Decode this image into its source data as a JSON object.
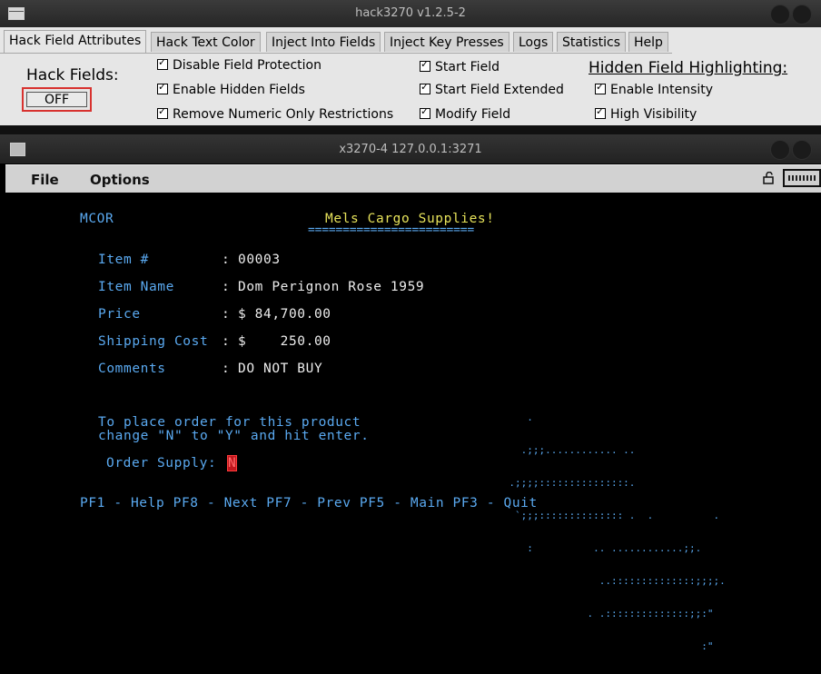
{
  "window": {
    "title": "hack3270 v1.2.5-2"
  },
  "tabs": [
    "Hack Field Attributes",
    "Hack Text Color",
    "Inject Into Fields",
    "Inject Key Presses",
    "Logs",
    "Statistics",
    "Help"
  ],
  "hack_fields": {
    "label": "Hack Fields:",
    "toggle": "OFF"
  },
  "options_left": [
    "Disable Field Protection",
    "Enable Hidden Fields",
    "Remove Numeric Only Restrictions"
  ],
  "options_mid": [
    "Start Field",
    "Start Field Extended",
    "Modify Field"
  ],
  "hidden_highlight": {
    "label": "Hidden Field Highlighting:",
    "options": [
      "Enable Intensity",
      "High Visibility"
    ]
  },
  "terminal_window": {
    "title": "x3270-4 127.0.0.1:3271"
  },
  "terminal_menu": [
    "File",
    "Options"
  ],
  "screen": {
    "code": "MCOR",
    "title": "Mels Cargo Supplies!",
    "underline": "========================",
    "fields": [
      {
        "label": "Item #",
        "value": "00003"
      },
      {
        "label": "Item Name",
        "value": "Dom Perignon Rose 1959"
      },
      {
        "label": "Price",
        "value": "$ 84,700.00"
      },
      {
        "label": "Shipping Cost",
        "value": "$    250.00"
      },
      {
        "label": "Comments",
        "value": "DO NOT BUY"
      }
    ],
    "instruction_1": "To place order for this product",
    "instruction_2": "change \"N\" to \"Y\" and hit enter.",
    "order_label": "Order Supply:",
    "order_value": "N",
    "pf_keys": "PF1 - Help PF8 - Next PF7 - Prev PF5 - Main PF3 - Quit",
    "ascii_art": [
      "          .",
      "         .;;;............ ..",
      "       .;;;;:::::::::::::::.",
      "        `;;;:::::::::::::: .  .          .",
      "          :          .. ............;;.",
      "                      ..::::::::::::::;;;;.",
      "                    . .::::::::::::::;;:\"",
      "                                       :\""
    ]
  },
  "icons": [
    "window-menu-icon",
    "terminal-icon",
    "lock-icon",
    "keyboard-icon",
    "checkmark-icon"
  ]
}
